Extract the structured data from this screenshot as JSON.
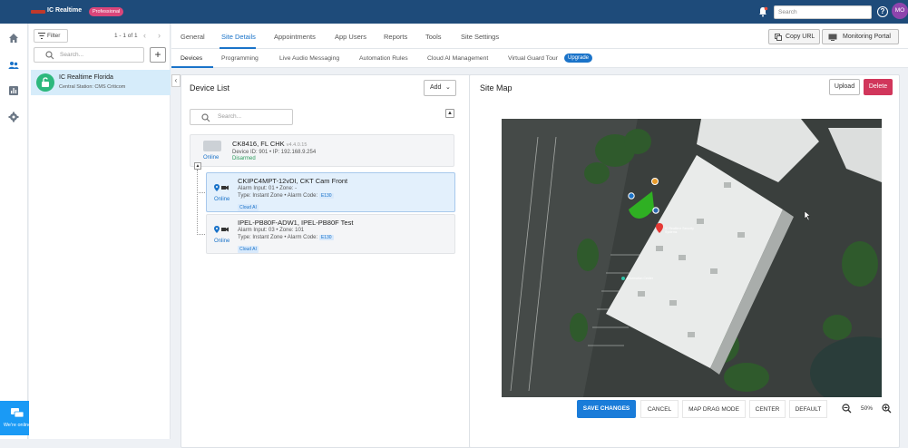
{
  "app": {
    "brand": "IC Realtime",
    "plan_badge": "Professional",
    "search_placeholder": "Search",
    "avatar_initials": "MO"
  },
  "leftnav": {
    "items": [
      "home-icon",
      "users-icon",
      "reports-icon",
      "settings-icon"
    ],
    "chat_label": "We're online"
  },
  "site_panel": {
    "filter_label": "Filter",
    "pager_text": "1 - 1 of 1",
    "search_placeholder": "Search...",
    "add_label": "+",
    "sites": [
      {
        "name": "IC Realtime Florida",
        "sub": "Central Station: CMS Criticom"
      }
    ]
  },
  "tabs_main": [
    "General",
    "Site Details",
    "Appointments",
    "App Users",
    "Reports",
    "Tools",
    "Site Settings"
  ],
  "active_main_tab": "Site Details",
  "header_actions": {
    "copy_url": "Copy URL",
    "monitoring_portal": "Monitoring Portal"
  },
  "tabs_sub": [
    "Devices",
    "Programming",
    "Live Audio Messaging",
    "Automation Rules",
    "Cloud AI Management",
    "Virtual Guard Tour"
  ],
  "upgrade_badge": "Upgrade",
  "device_list": {
    "title": "Device List",
    "add_label": "Add",
    "search_placeholder": "Search...",
    "hub": {
      "name": "CK8416, FL CHK",
      "version": "v4.4.0.15",
      "line": "Device ID: 901 • IP: 192.168.9.254",
      "status": "Disarmed",
      "online": "Online"
    },
    "cameras": [
      {
        "name": "CKIPC4MPT-12vDI, CKT Cam Front",
        "line1": "Alarm Input: 01 • Zone: -",
        "line2_prefix": "Type: Instant Zone • Alarm Code:",
        "code": "E130",
        "tag": "Cloud AI",
        "online": "Online"
      },
      {
        "name": "IPEL-PB80F-ADW1, IPEL-PB80F Test",
        "line1": "Alarm Input: 03 • Zone: 101",
        "line2_prefix": "Type: Instant Zone • Alarm Code:",
        "code": "E130",
        "tag": "Cloud AI",
        "online": "Online"
      }
    ]
  },
  "site_map": {
    "title": "Site Map",
    "upload": "Upload",
    "delete": "Delete",
    "toolbar": {
      "save": "SAVE CHANGES",
      "cancel": "CANCEL",
      "drag": "MAP DRAG MODE",
      "center": "CENTER",
      "default": "DEFAULT",
      "zoom": "50%"
    },
    "map_labels": {
      "company": "IC Realtime Security Systems",
      "info": "Information Center"
    }
  },
  "colors": {
    "topbar": "#1e4b7a",
    "accent": "#1a73c9",
    "delete": "#d1365b",
    "online_site": "#2db87d"
  }
}
